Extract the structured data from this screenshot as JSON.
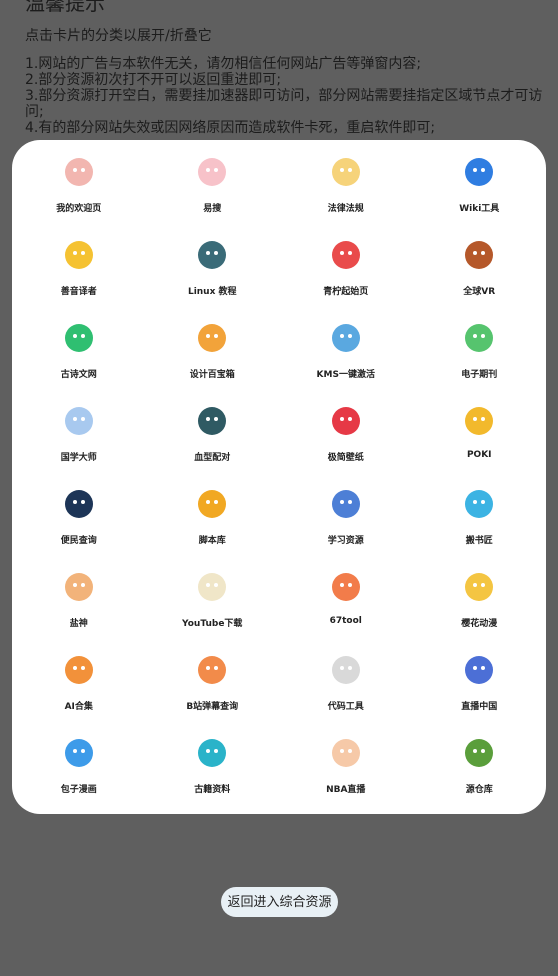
{
  "tips": {
    "title": "温馨提示",
    "subtitle": "点击卡片的分类以展开/折叠它",
    "lines": [
      "1.网站的广告与本软件无关，请勿相信任何网站广告等弹窗内容;",
      "2.部分资源初次打不开可以返回重进即可;",
      "3.部分资源打开空白，需要挂加速器即可访问，部分网站需要挂指定区域节点才可访问;",
      "4.有的部分网站失效或因网络原因而造成软件卡死，重启软件即可;"
    ]
  },
  "grid": [
    {
      "label": "我的欢迎页",
      "icon": "avatar-icon",
      "color": "#f2b6b0"
    },
    {
      "label": "易搜",
      "icon": "peach-icon",
      "color": "#f7c2c9"
    },
    {
      "label": "法律法规",
      "icon": "chick-icon",
      "color": "#f6d37a"
    },
    {
      "label": "Wiki工具",
      "icon": "globe-icon",
      "color": "#2f7de1"
    },
    {
      "label": "善音译者",
      "icon": "emoji-icon",
      "color": "#f5c232"
    },
    {
      "label": "Linux 教程",
      "icon": "cat-icon",
      "color": "#3a6b78"
    },
    {
      "label": "青柠起始页",
      "icon": "watermelon-icon",
      "color": "#e94b4b"
    },
    {
      "label": "全球VR",
      "icon": "chestnut-icon",
      "color": "#b5582a"
    },
    {
      "label": "古诗文网",
      "icon": "heart-card-icon",
      "color": "#2fbf71"
    },
    {
      "label": "设计百宝箱",
      "icon": "designer-icon",
      "color": "#f2a33a"
    },
    {
      "label": "KMS一键激活",
      "icon": "brackets-icon",
      "color": "#5aa8e0"
    },
    {
      "label": "电子期刊",
      "icon": "frog-icon",
      "color": "#56c46e"
    },
    {
      "label": "国学大师",
      "icon": "cloud-icon",
      "color": "#a8c9ef"
    },
    {
      "label": "血型配对",
      "icon": "bird-icon",
      "color": "#2f5a63"
    },
    {
      "label": "极简壁纸",
      "icon": "mountain-icon",
      "color": "#e63946"
    },
    {
      "label": "POKI",
      "icon": "bag-icon",
      "color": "#f2b92c"
    },
    {
      "label": "便民查询",
      "icon": "search-icon",
      "color": "#1d3557"
    },
    {
      "label": "脚本库",
      "icon": "coin-icon",
      "color": "#f1a823"
    },
    {
      "label": "学习资源",
      "icon": "mail-icon",
      "color": "#4d7fd6"
    },
    {
      "label": "搬书匠",
      "icon": "robot-icon",
      "color": "#3cb3e3"
    },
    {
      "label": "盐神",
      "icon": "tiger-icon",
      "color": "#f2b37a"
    },
    {
      "label": "YouTube下载",
      "icon": "arrow-icon",
      "color": "#f0e6c8"
    },
    {
      "label": "67tool",
      "icon": "fox-icon",
      "color": "#f27c4a"
    },
    {
      "label": "樱花动漫",
      "icon": "princess-icon",
      "color": "#f4c542"
    },
    {
      "label": "AI合集",
      "icon": "cat-face-icon",
      "color": "#f2913a"
    },
    {
      "label": "B站弹幕查询",
      "icon": "girl-icon",
      "color": "#f28b4a"
    },
    {
      "label": "代码工具",
      "icon": "sheep-icon",
      "color": "#d9d9d9"
    },
    {
      "label": "直播中国",
      "icon": "clover-icon",
      "color": "#4c6fd6"
    },
    {
      "label": "包子漫画",
      "icon": "shield-smile-icon",
      "color": "#3d9be9"
    },
    {
      "label": "古籍资料",
      "icon": "umbrella-icon",
      "color": "#2ab3c9"
    },
    {
      "label": "NBA直播",
      "icon": "kitten-icon",
      "color": "#f6c9a8"
    },
    {
      "label": "源仓库",
      "icon": "sprout-icon",
      "color": "#5a9e3b"
    }
  ],
  "back_button": {
    "label": "返回进入综合资源"
  }
}
